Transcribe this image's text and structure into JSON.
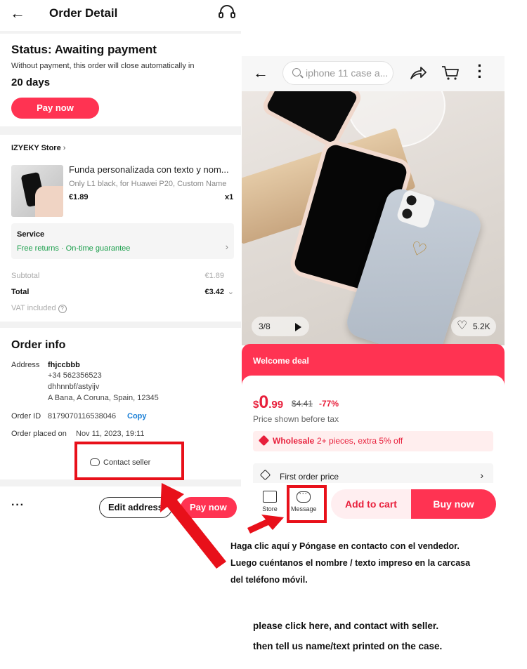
{
  "order_detail": {
    "header": {
      "back_icon": "back-arrow-icon",
      "title": "Order Detail",
      "support_icon": "headset-icon"
    },
    "status": {
      "title": "Status: Awaiting payment",
      "subtitle": "Without payment, this order will close automatically in",
      "days": "20 days",
      "pay_label": "Pay now"
    },
    "store": {
      "name": "IZYEKY Store",
      "product_title": "Funda personalizada con texto y nom...",
      "variant": "Only L1 black, for Huawei P20, Custom Name",
      "price": "€1.89",
      "qty": "x1"
    },
    "service": {
      "title": "Service",
      "text": "Free returns · On-time guarantee"
    },
    "summary": {
      "subtotal_label": "Subtotal",
      "subtotal": "€1.89",
      "total_label": "Total",
      "total": "€3.42",
      "vat_label": "VAT included"
    },
    "order_info": {
      "title": "Order info",
      "address_label": "Address",
      "name": "fhjccbbb",
      "phone": "+34 562356523",
      "street": "dhhnnbf/astyijv",
      "city": "A Bana, A Coruna, Spain, 12345",
      "order_id_label": "Order ID",
      "order_id": "8179070116538046",
      "copy_label": "Copy",
      "placed_label": "Order placed on",
      "placed_date": "Nov 11, 2023, 19:11",
      "contact_label": "Contact seller"
    },
    "bottom": {
      "more": "···",
      "edit_label": "Edit address",
      "pay_label": "Pay now"
    }
  },
  "product": {
    "toolbar": {
      "search_placeholder": "iphone 11 case a..."
    },
    "gallery": {
      "pager": "3/8",
      "likes": "5.2K"
    },
    "deal": "Welcome deal",
    "price": {
      "currency": "$",
      "whole": "0",
      "decimal": ".99",
      "old": "$4.41",
      "discount": "-77%"
    },
    "tax_note": "Price shown before tax",
    "wholesale": {
      "label": "Wholesale",
      "text": "2+ pieces, extra 5% off"
    },
    "first_order": "First order price",
    "actions": {
      "store": "Store",
      "message": "Message",
      "add_to_cart": "Add to cart",
      "buy_now": "Buy now"
    }
  },
  "instructions": {
    "es_line1": "Haga clic aquí y Póngase en contacto con el vendedor.",
    "es_line2": "Luego cuéntanos el nombre / texto impreso en la carcasa",
    "es_line3": "del teléfono móvil.",
    "en_line1": "please click here, and contact with seller.",
    "en_line2": "then tell us name/text printed on the case."
  },
  "colors": {
    "accent": "#ff3352",
    "highlight_box": "#e8101a",
    "service_green": "#1a9e4b",
    "copy_blue": "#1a7fd6"
  }
}
